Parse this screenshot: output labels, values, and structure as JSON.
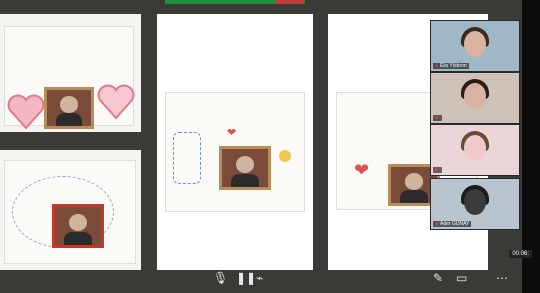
{
  "participants": [
    {
      "name": "Elis Yıldırım"
    },
    {
      "name": ""
    },
    {
      "name": ""
    },
    {
      "name": "Ader GÜNAY"
    }
  ],
  "badge": "00:06:",
  "colors": {
    "background": "#3b3a36",
    "meetingGreen": "#1f8f3a",
    "meetingRed": "#c03a3a"
  },
  "controls": [
    "mic-icon",
    "pause-icon",
    "share-icon",
    "pen-icon",
    "screen-icon",
    "more-icon"
  ]
}
